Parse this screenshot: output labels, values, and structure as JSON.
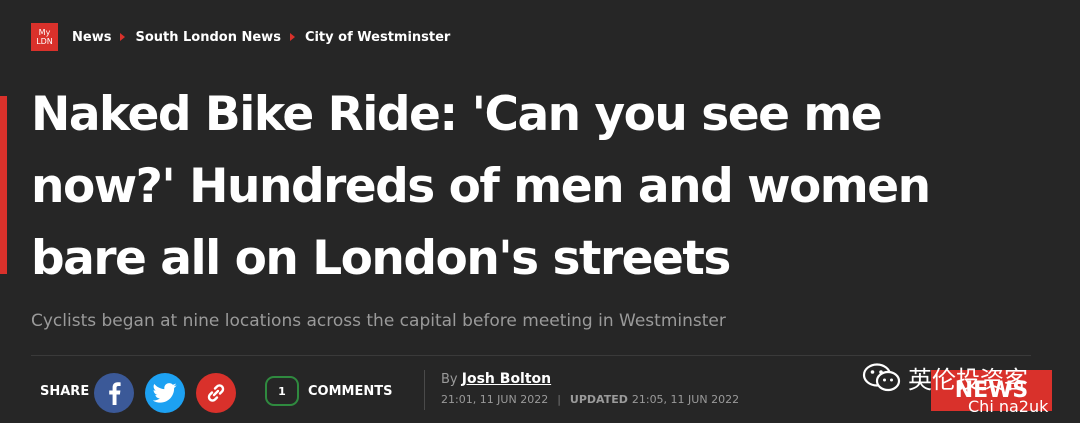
{
  "breadcrumb": {
    "logo_top": "My",
    "logo_bottom": "LDN",
    "items": [
      "News",
      "South London News",
      "City of Westminster"
    ]
  },
  "article": {
    "headline": "Naked Bike Ride: 'Can you see me now?' Hundreds of men and women bare all on London's streets",
    "subtitle": "Cyclists began at nine locations across the capital before meeting in Westminster"
  },
  "share": {
    "label": "SHARE",
    "icons": [
      "facebook-icon",
      "twitter-icon",
      "link-icon"
    ]
  },
  "comments": {
    "count": "1",
    "label": "COMMENTS"
  },
  "byline": {
    "prefix": "By",
    "author": "Josh Bolton",
    "published": "21:01, 11 JUN 2022",
    "updated_label": "UPDATED",
    "updated": "21:05, 11 JUN 2022"
  },
  "overlay": {
    "wechat_text": "英伦投资客",
    "news_badge": "NEWS",
    "site_mark": "Chi na2uk"
  },
  "colors": {
    "accent": "#d9312b",
    "background": "#262626",
    "facebook": "#3b5998",
    "twitter": "#1da1f2",
    "comment_border": "#2f8a3f"
  }
}
